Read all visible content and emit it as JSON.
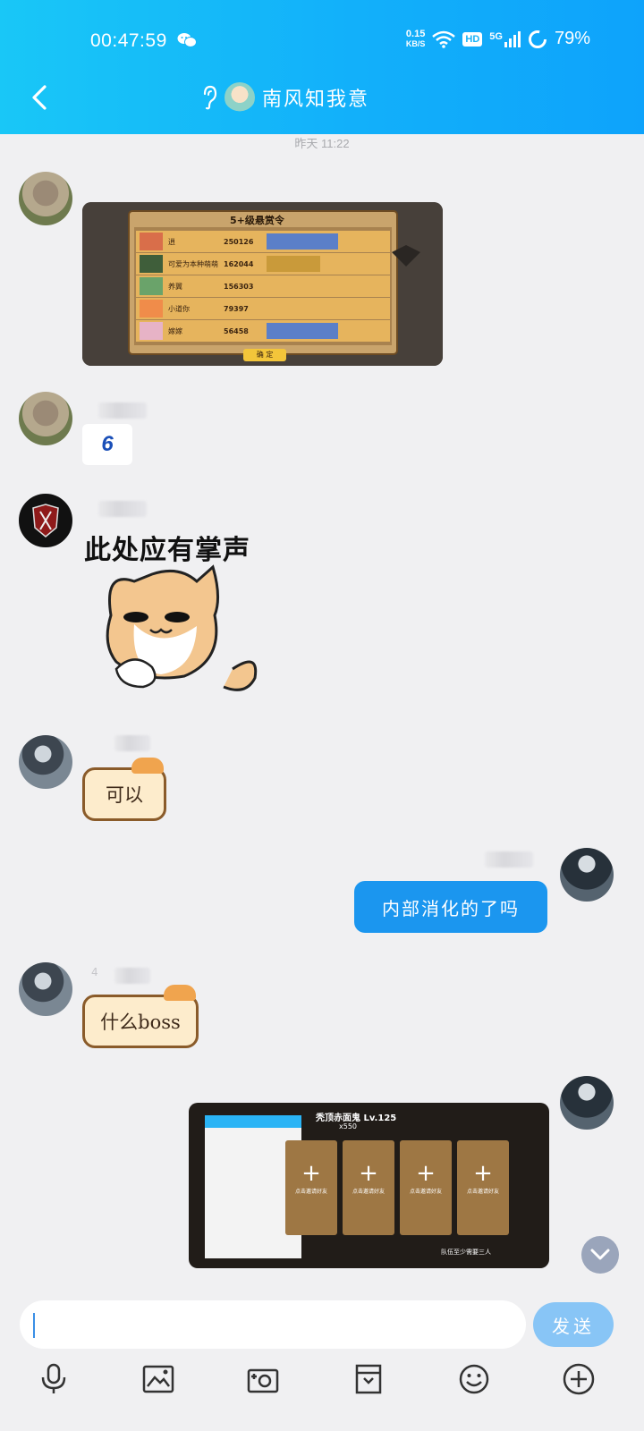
{
  "status_bar": {
    "time": "00:47:59",
    "net_speed_value": "0.15",
    "net_speed_unit": "KB/S",
    "hd_label": "HD",
    "signal_label": "5G",
    "battery": "79%"
  },
  "header": {
    "title": "南风知我意"
  },
  "chat": {
    "timestamp": "昨天 11:22",
    "messages": [
      {
        "type": "image",
        "content": "5+级悬赏令 leaderboard screenshot"
      },
      {
        "type": "text",
        "text": "6"
      },
      {
        "type": "sticker",
        "text": "此处应有掌声"
      },
      {
        "type": "cat-bubble",
        "text": "可以"
      },
      {
        "type": "self-bubble",
        "text": "内部消化的了吗"
      },
      {
        "type": "cat-bubble",
        "text": "什么boss"
      },
      {
        "type": "image",
        "content": "game screenshot"
      }
    ],
    "bubble_second_name_prefix": "4"
  },
  "leaderboard": {
    "title": "5+级悬赏令",
    "confirm": "确 定",
    "rows": [
      {
        "name": "逍",
        "score": "250126"
      },
      {
        "name": "可爱为本种萌萌",
        "score": "162044"
      },
      {
        "name": "养翼",
        "score": "156303"
      },
      {
        "name": "小道你",
        "score": "79397"
      },
      {
        "name": "嫁嫁",
        "score": "56458"
      }
    ]
  },
  "game_shot": {
    "boss": "秃顶赤面鬼 Lv.125",
    "reward": "x550",
    "slot_label": "点击邀请好友",
    "footer": "队伍至少需要三人"
  },
  "input": {
    "placeholder": "",
    "send_label": "发送"
  },
  "toolbar": {
    "icons": [
      "microphone-icon",
      "image-icon",
      "camera-icon",
      "file-icon",
      "emoji-icon",
      "plus-icon"
    ]
  },
  "colors": {
    "header_start": "#19c7f7",
    "header_end": "#0ea3fb",
    "self_bubble": "#1b96ef",
    "send_button": "#88c5f6"
  }
}
